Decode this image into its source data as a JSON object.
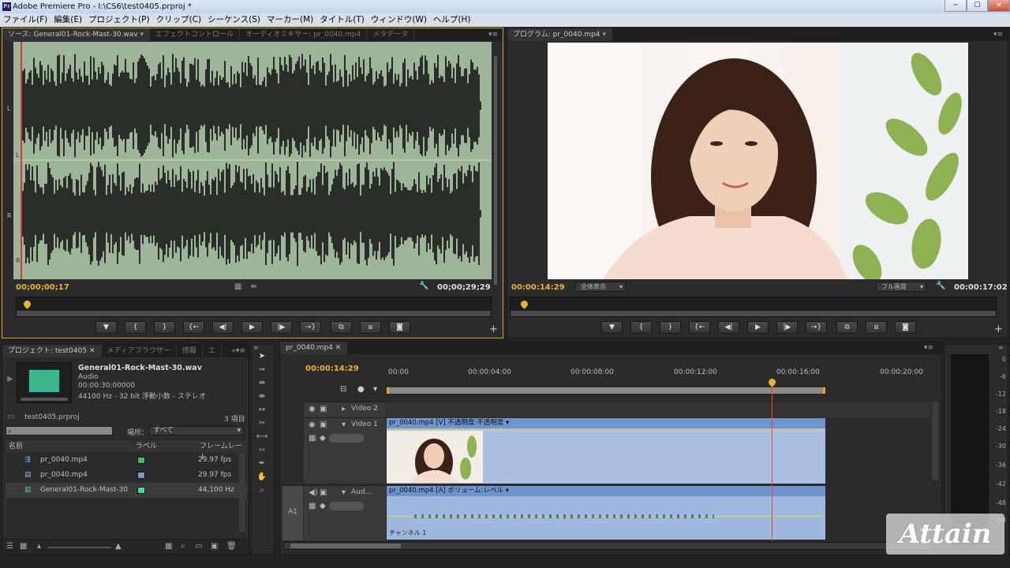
{
  "window": {
    "title": "Adobe Premiere Pro - I:\\CS6\\test0405.prproj *",
    "app_icon": "Pr",
    "minimize": "─",
    "maximize": "☐",
    "close": "✕"
  },
  "menu": [
    "ファイル(F)",
    "編集(E)",
    "プロジェクト(P)",
    "クリップ(C)",
    "シーケンス(S)",
    "マーカー(M)",
    "タイトル(T)",
    "ウィンドウ(W)",
    "ヘルプ(H)"
  ],
  "source_panel": {
    "tabs": [
      "ソース: General01-Rock-Mast-30.wav",
      "エフェクトコントロール",
      "オーディオミキサー: pr_0040.mp4",
      "メタデータ"
    ],
    "channel_labels": [
      "L",
      "L",
      "R",
      "R"
    ],
    "timecode_current": "00;00;00;17",
    "timecode_duration": "00;00;29;29"
  },
  "program_panel": {
    "tab": "プログラム: pr_0040.mp4",
    "timecode_current": "00:00:14:29",
    "fit": "全体表示",
    "quality": "フル画質",
    "timecode_duration": "00:00:17:02"
  },
  "transport_icons": {
    "marker": "▼",
    "in": "{",
    "out": "}",
    "goto_in": "{←",
    "step_back": "◀|",
    "play": "▶",
    "step_fwd": "|▶",
    "goto_out": "→}",
    "insert": "⧉",
    "overwrite": "⧈",
    "export": "◙",
    "add": "+",
    "wrench": "🔧",
    "drag_video": "▦",
    "drag_audio": "⇻"
  },
  "project_panel": {
    "tabs": [
      "プロジェクト: test0405",
      "メディアブラウザー",
      "情報",
      "エ"
    ],
    "clip_name": "General01-Rock-Mast-30.wav",
    "clip_type": "Audio",
    "clip_duration": "00:00:30:00000",
    "clip_format": "44100 Hz - 32 bit 浮動小数 - ステレオ",
    "project_file": "test0405.prproj",
    "item_count": "3 項目",
    "search_placeholder": "",
    "in_label": "場所：",
    "in_value": "すべて",
    "columns": [
      "名前",
      "ラベル",
      "フレームレート"
    ],
    "items": [
      {
        "name": "pr_0040.mp4",
        "label_color": "#3fbf5a",
        "rate": "29.97 fps",
        "icon": "sequence-icon"
      },
      {
        "name": "pr_0040.mp4",
        "label_color": "#7f98c9",
        "rate": "29.97 fps",
        "icon": "video-clip-icon"
      },
      {
        "name": "General01-Rock-Mast-30",
        "label_color": "#4bd690",
        "rate": "44,100 Hz",
        "icon": "audio-clip-icon"
      }
    ]
  },
  "timeline": {
    "tab": "pr_0040.mp4",
    "timecode": "00:00:14:29",
    "ruler": [
      "00:00",
      "00:00:04:00",
      "00:00:08:00",
      "00:00:12:00",
      "00:00:16:00",
      "00:00:20:00"
    ],
    "tracks": {
      "video2": "Video 2",
      "video1": "Video 1",
      "audio1": "Aud...",
      "audio_header": "A1"
    },
    "video_clip_label": "pr_0040.mp4 [V] 不透明度:不透明度",
    "audio_clip_label": "pr_0040.mp4 [A] ボリューム:レベル",
    "audio_channel": "チャンネル 1"
  },
  "meters": {
    "scale": [
      "0",
      "-6",
      "-12",
      "-18",
      "-24",
      "-30",
      "-36",
      "-42",
      "-48",
      "-54"
    ]
  },
  "watermark": "Attain",
  "colors": {
    "timecode": "#e8b22b",
    "waveform_bg": "#9fb59a",
    "clip_video": "#7f9ed0",
    "clip_audio": "#82a3d4",
    "playhead": "#e8453c"
  }
}
